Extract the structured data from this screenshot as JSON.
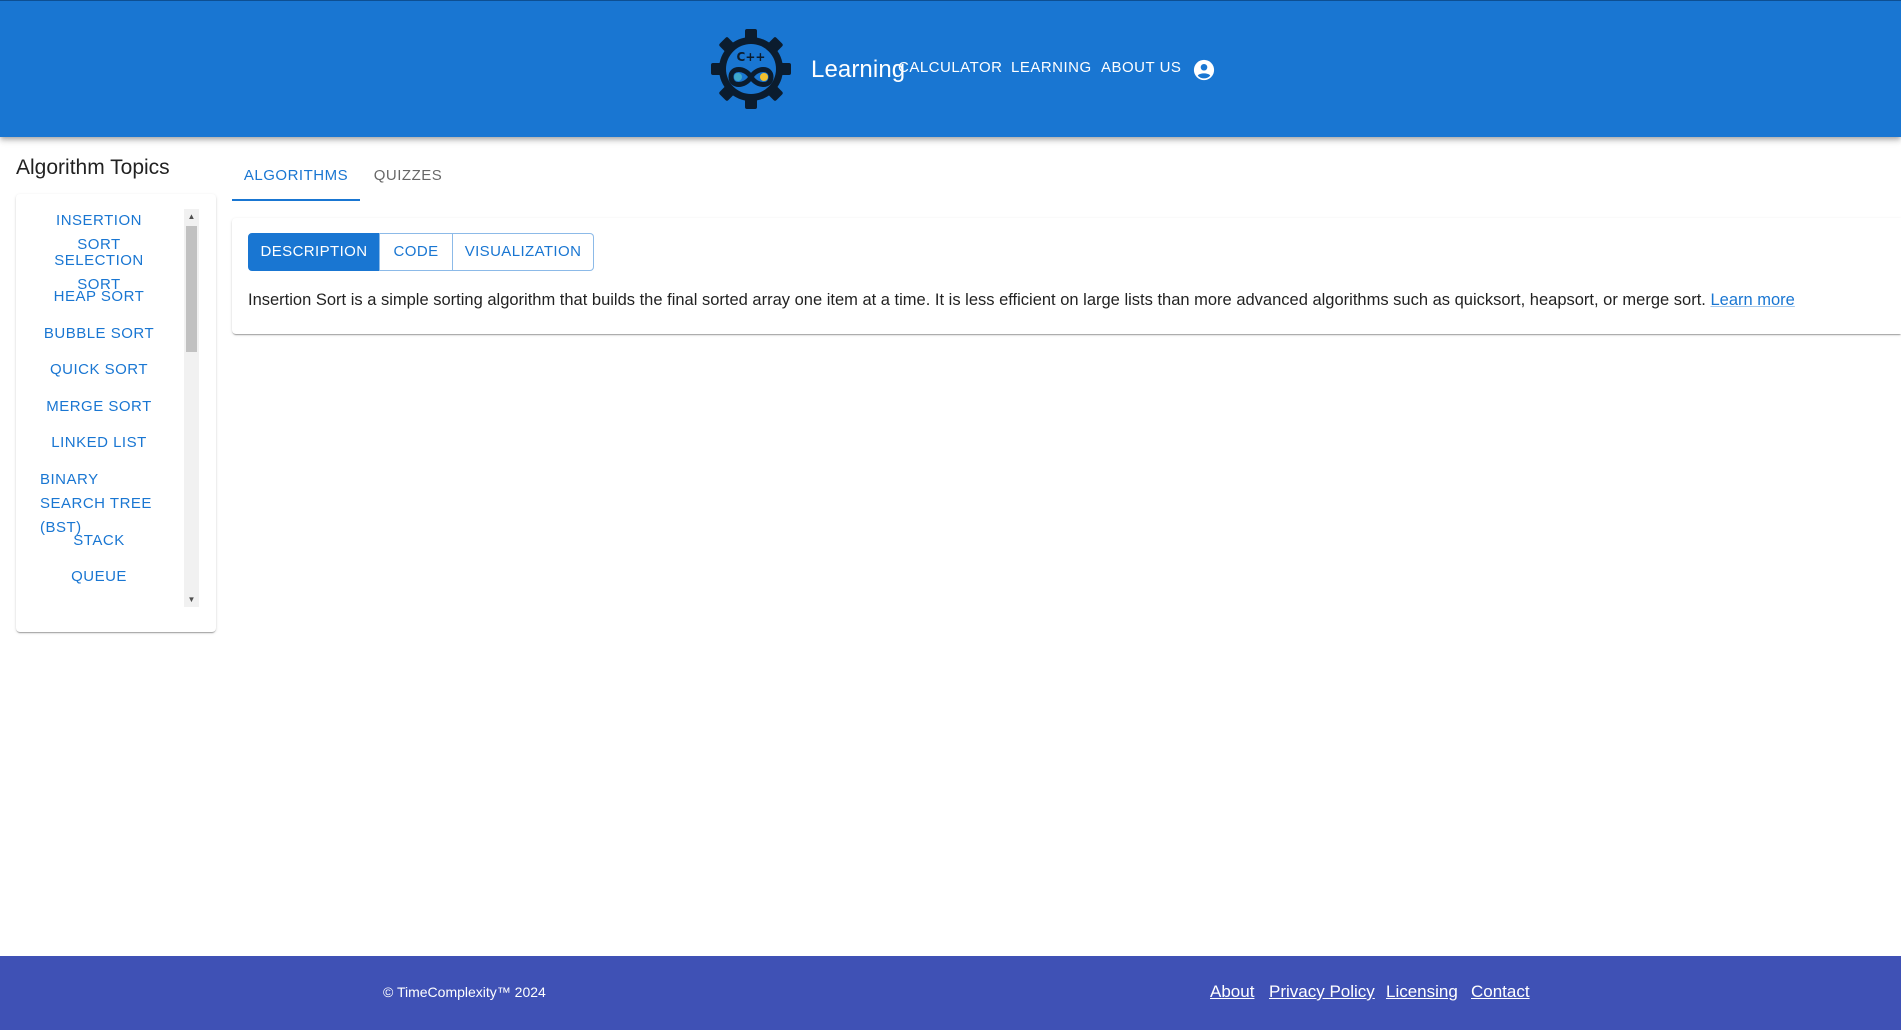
{
  "header": {
    "brand": "Learning",
    "nav": {
      "calculator": "CALCULATOR",
      "learning": "LEARNING",
      "about_us": "ABOUT US"
    },
    "logo_icon": "gear-infinity-logo",
    "account_icon": "account-circle-icon",
    "colors": {
      "bar": "#1976d2"
    }
  },
  "sidebar": {
    "title": "Algorithm Topics",
    "items": [
      {
        "label": "INSERTION SORT"
      },
      {
        "label": "SELECTION SORT"
      },
      {
        "label": "HEAP SORT"
      },
      {
        "label": "BUBBLE SORT"
      },
      {
        "label": "QUICK SORT"
      },
      {
        "label": "MERGE SORT"
      },
      {
        "label": "LINKED LIST"
      },
      {
        "label": "BINARY SEARCH TREE (BST)"
      },
      {
        "label": "STACK"
      },
      {
        "label": "QUEUE"
      }
    ]
  },
  "main": {
    "tabs": [
      {
        "label": "ALGORITHMS",
        "active": true
      },
      {
        "label": "QUIZZES",
        "active": false
      }
    ],
    "view_buttons": [
      {
        "label": "DESCRIPTION",
        "active": true
      },
      {
        "label": "CODE",
        "active": false
      },
      {
        "label": "VISUALIZATION",
        "active": false
      }
    ],
    "description": "Insertion Sort is a simple sorting algorithm that builds the final sorted array one item at a time. It is less efficient on large lists than more advanced algorithms such as quicksort, heapsort, or merge sort.",
    "learn_more": "Learn more"
  },
  "footer": {
    "copyright": "© TimeComplexity™ 2024",
    "links": {
      "about": "About",
      "privacy": "Privacy Policy",
      "licensing": "Licensing",
      "contact": "Contact"
    },
    "colors": {
      "background": "#3f51b5"
    }
  }
}
